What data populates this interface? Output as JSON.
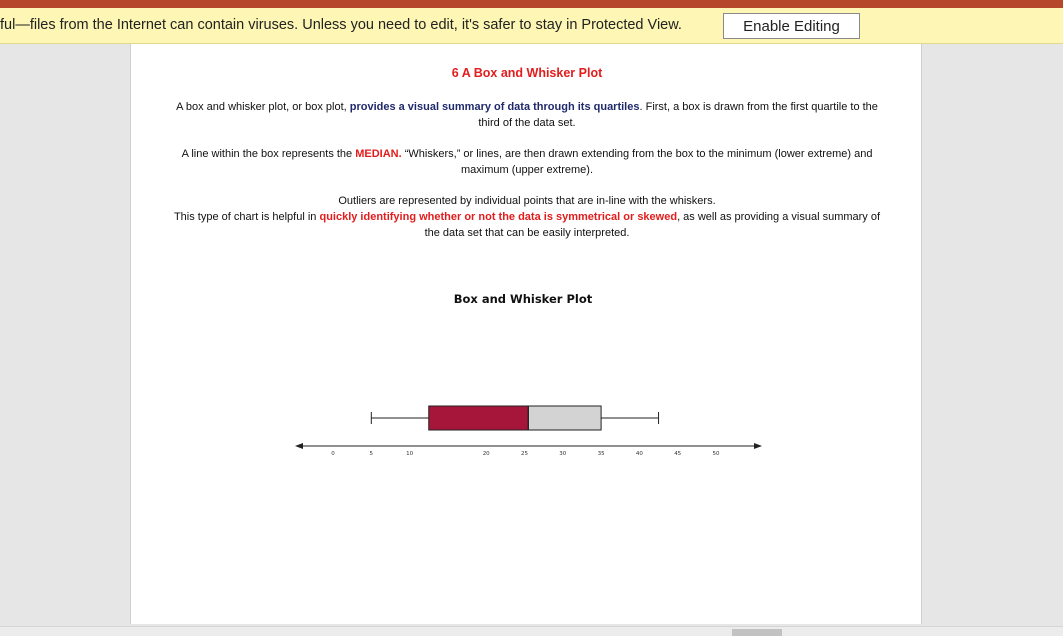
{
  "banner": {
    "message": "ful—files from the Internet can contain viruses. Unless you need to edit, it's safer to stay in Protected View.",
    "enable_editing_label": "Enable Editing"
  },
  "document": {
    "title": "6  A Box and Whisker Plot",
    "para1": {
      "pre": "A box and whisker plot, or box plot, ",
      "highlight": "provides a visual summary of data through its quartiles",
      "post": ". First, a box is drawn from the first quartile to the third of the data set."
    },
    "para2": {
      "pre": "A line within the box represents the ",
      "highlight": "MEDIAN.",
      "post": " “Whiskers,” or lines, are then drawn extending from the box to the minimum (lower extreme) and maximum (upper extreme)."
    },
    "para3": {
      "line1": "Outliers are represented by individual points that are in-line with the whiskers.",
      "pre": "This type of chart is helpful in ",
      "highlight": "quickly identifying whether or not the data is symmetrical or skewed",
      "post": ", as well as providing a visual summary of the data set that can be easily interpreted."
    }
  },
  "chart_data": {
    "type": "box",
    "title": "Box and Whisker Plot",
    "x_ticks": [
      0,
      5,
      10,
      20,
      25,
      30,
      35,
      40,
      45,
      50
    ],
    "min": 5,
    "q1": 12.5,
    "median": 25.5,
    "q3": 35,
    "max": 42.5,
    "colors": {
      "lower_box": "#a6163a",
      "upper_box": "#d3d3d3",
      "stroke": "#222222"
    }
  }
}
